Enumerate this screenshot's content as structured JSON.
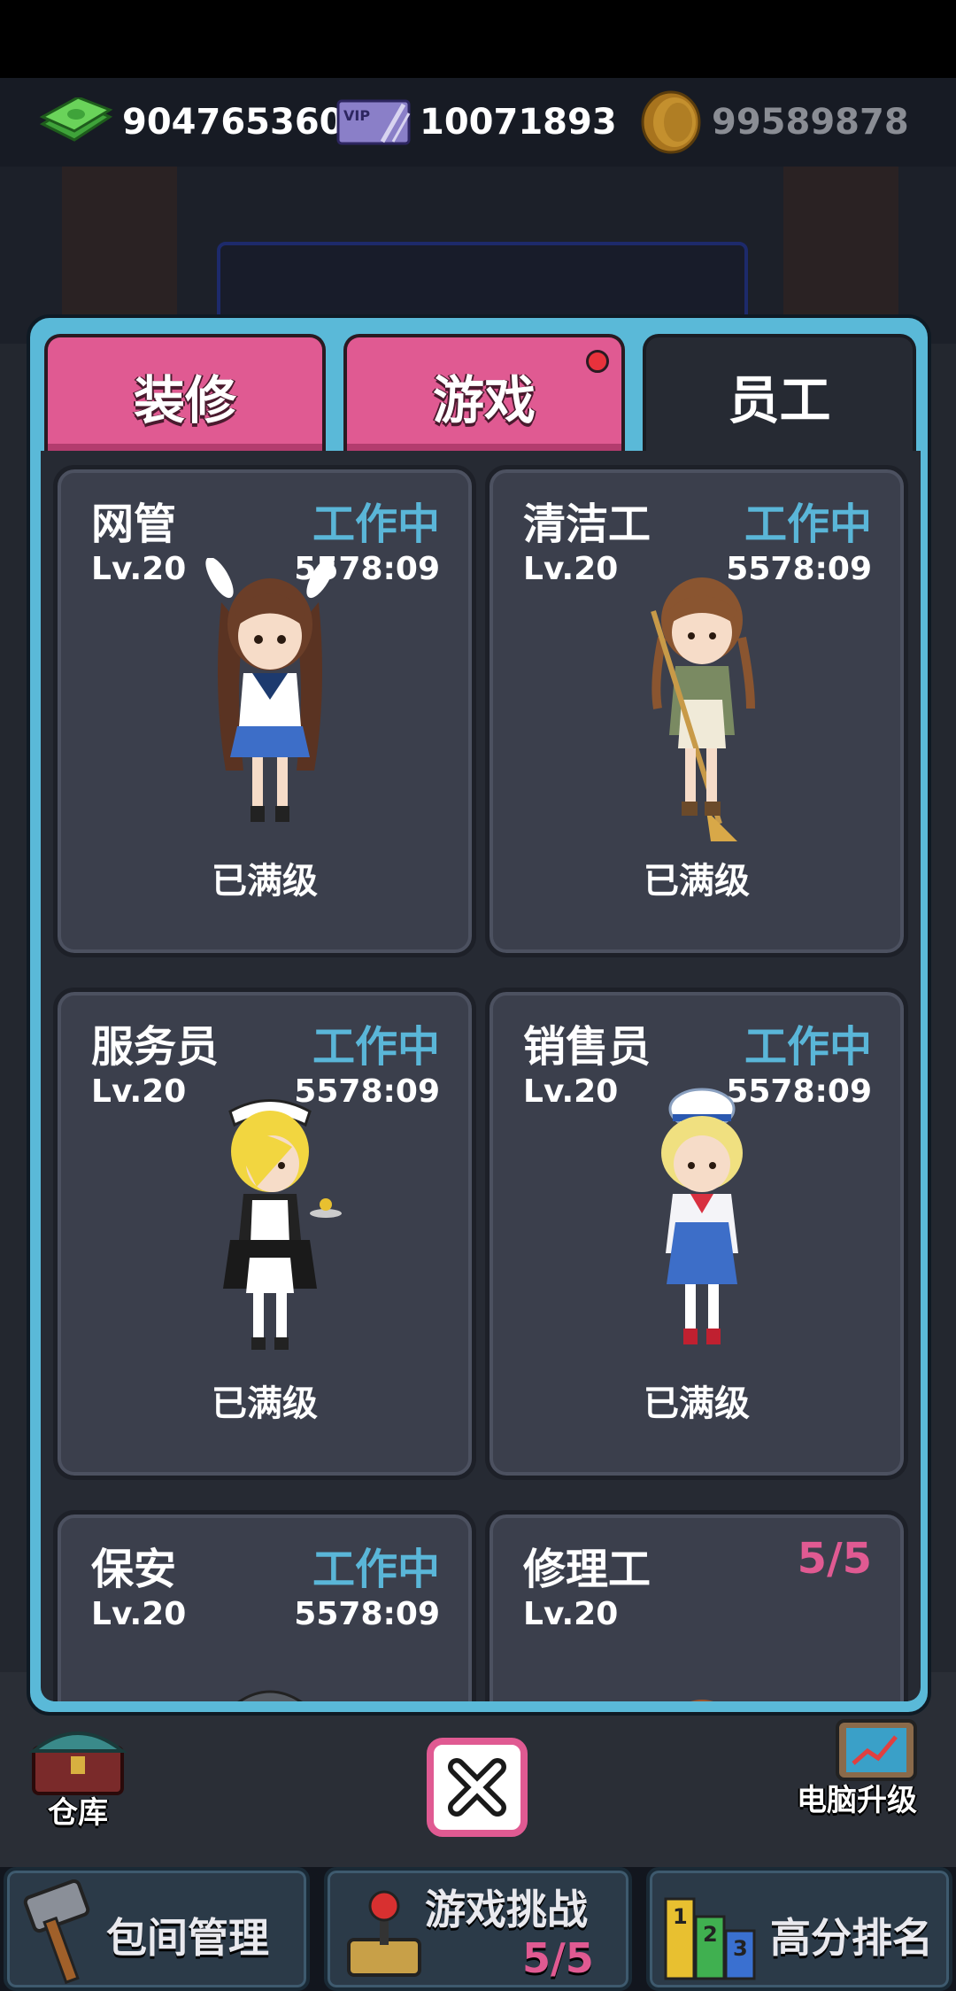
{
  "resources": {
    "cash": "904765360",
    "vip": "10071893",
    "coins": "99589878",
    "vip_badge": "VIP",
    "icons": [
      "cash-stack-icon",
      "vip-card-icon",
      "gold-coin-icon"
    ]
  },
  "tabs": [
    {
      "label": "装修",
      "active": false,
      "has_notification": false
    },
    {
      "label": "游戏",
      "active": false,
      "has_notification": true
    },
    {
      "label": "员工",
      "active": true,
      "has_notification": false
    }
  ],
  "staff": [
    {
      "name": "网管",
      "status": "工作中",
      "level": "Lv.20",
      "timer": "5578:09",
      "note": "已满级"
    },
    {
      "name": "清洁工",
      "status": "工作中",
      "level": "Lv.20",
      "timer": "5578:09",
      "note": "已满级"
    },
    {
      "name": "服务员",
      "status": "工作中",
      "level": "Lv.20",
      "timer": "5578:09",
      "note": "已满级"
    },
    {
      "name": "销售员",
      "status": "工作中",
      "level": "Lv.20",
      "timer": "5578:09",
      "note": "已满级"
    },
    {
      "name": "保安",
      "status": "工作中",
      "level": "Lv.20",
      "timer": "5578:09",
      "note": ""
    },
    {
      "name": "修理工",
      "status": "5/5",
      "level": "Lv.20",
      "timer": "",
      "note": ""
    }
  ],
  "side_buttons": {
    "warehouse": "仓库",
    "pc_upgrade": "电脑升级"
  },
  "bottom_nav": {
    "room_manage": "包间管理",
    "game_challenge": "游戏挑战",
    "game_challenge_count": "5/5",
    "leaderboard": "高分排名",
    "leaderboard_ranks": [
      "1",
      "2",
      "3"
    ]
  },
  "colors": {
    "panel_border": "#5ab9d8",
    "tab_pink": "#e05a92",
    "status_working": "#5ab6d8",
    "status_count": "#e05a92",
    "card_bg": "#3b3f4c"
  }
}
